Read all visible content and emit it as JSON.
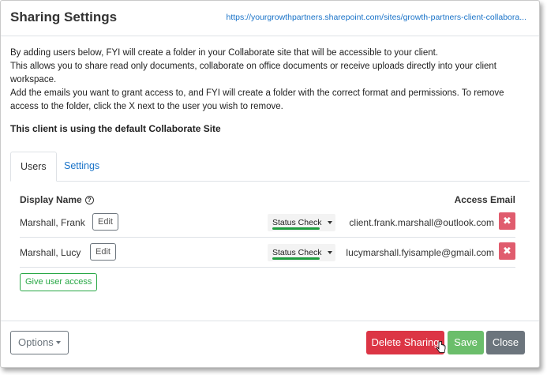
{
  "dialog": {
    "title": "Sharing Settings",
    "site_url": "https://yourgrowthpartners.sharepoint.com/sites/growth-partners-client-collabora..."
  },
  "intro": {
    "p1": "By adding users below, FYI will create a folder in your Collaborate site that will be accessible to your client.",
    "p2": "This allows you to share read only documents, collaborate on office documents or receive uploads directly into your client workspace.",
    "p3": "Add the emails you want to grant access to, and FYI will create a folder with the correct format and permissions. To remove access to the folder, click the X next to the user you wish to remove.",
    "default_site": "This client is using the default Collaborate Site"
  },
  "tabs": [
    {
      "label": "Users",
      "active": true
    },
    {
      "label": "Settings",
      "active": false
    }
  ],
  "table": {
    "col_name": "Display Name",
    "col_email": "Access Email",
    "rows": [
      {
        "name": "Marshall, Frank",
        "edit": "Edit",
        "status": "Status Check",
        "email": "client.frank.marshall@outlook.com",
        "remove": "✖"
      },
      {
        "name": "Marshall, Lucy",
        "edit": "Edit",
        "status": "Status Check",
        "email": "lucymarshall.fyisample@gmail.com",
        "remove": "✖"
      }
    ],
    "give_access": "Give user access"
  },
  "footer": {
    "options": "Options",
    "delete": "Delete Sharing",
    "save": "Save",
    "close": "Close"
  },
  "colors": {
    "danger": "#dc3545",
    "success": "#5cb85c",
    "secondary": "#6c757d",
    "link": "#1a73c8",
    "status_ok": "#1f9d3f"
  }
}
